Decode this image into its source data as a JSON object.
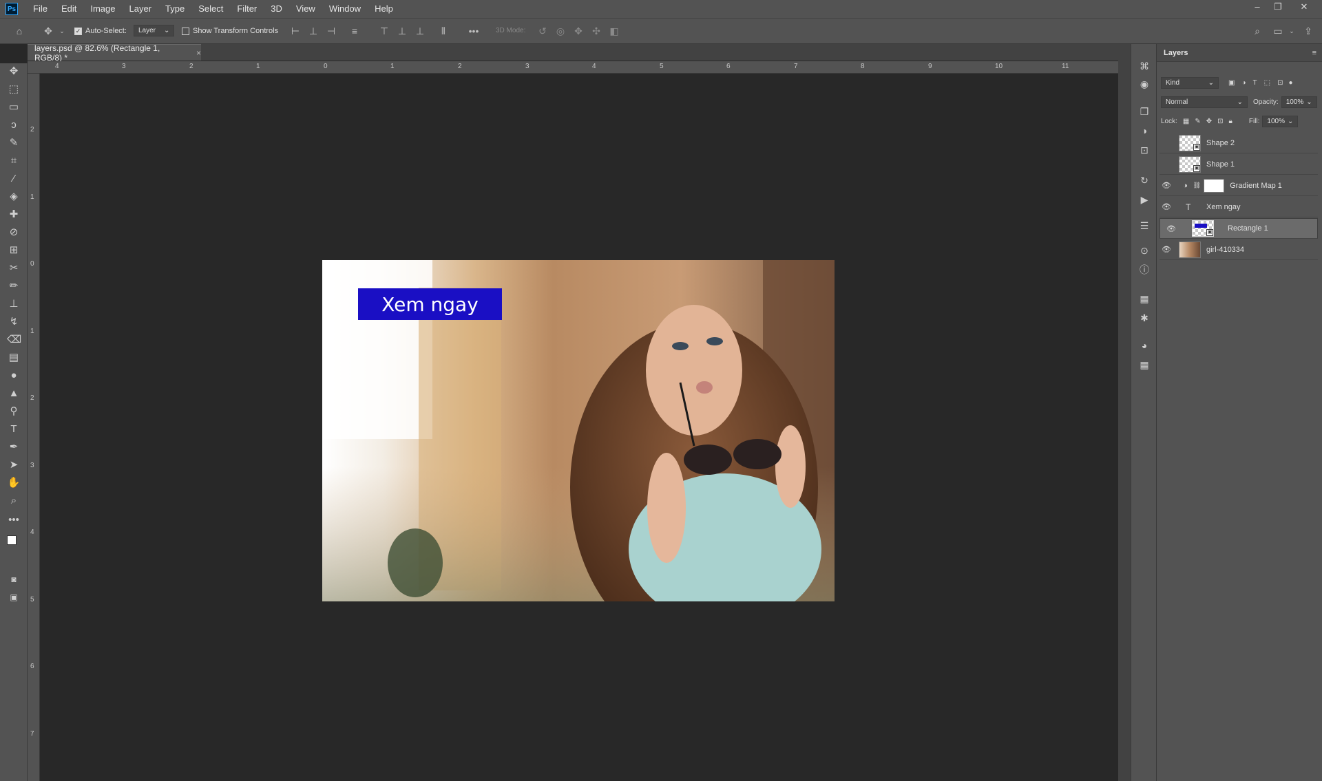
{
  "app": {
    "logo": "Ps"
  },
  "menu": [
    "File",
    "Edit",
    "Image",
    "Layer",
    "Type",
    "Select",
    "Filter",
    "3D",
    "View",
    "Window",
    "Help"
  ],
  "window_controls": {
    "minimize": "–",
    "restore": "❐",
    "close": "✕"
  },
  "options": {
    "auto_select_label": "Auto-Select:",
    "auto_select_value": "Layer",
    "show_transform_label": "Show Transform Controls",
    "mode_3d_label": "3D Mode:"
  },
  "document": {
    "tab_title": "layers.psd @ 82.6% (Rectangle 1, RGB/8) *",
    "close": "×"
  },
  "rulers": {
    "horizontal": [
      "4",
      "3",
      "2",
      "1",
      "0",
      "1",
      "2",
      "3",
      "4",
      "5",
      "6",
      "7",
      "8",
      "9",
      "10",
      "11"
    ],
    "vertical": [
      "2",
      "1",
      "0",
      "1",
      "2",
      "3",
      "4",
      "5",
      "6",
      "7"
    ]
  },
  "artwork": {
    "button_text": "Xem ngay",
    "button_color": "#1a0fc4"
  },
  "layers_panel": {
    "title": "Layers",
    "filter_kind": "Kind",
    "blend_mode": "Normal",
    "opacity_label": "Opacity:",
    "opacity_value": "100%",
    "lock_label": "Lock:",
    "fill_label": "Fill:",
    "fill_value": "100%",
    "layers": [
      {
        "name": "Shape 2",
        "visible": false
      },
      {
        "name": "Shape 1",
        "visible": false
      },
      {
        "name": "Gradient Map 1",
        "visible": true
      },
      {
        "name": "Xem ngay",
        "visible": true
      },
      {
        "name": "Rectangle 1",
        "visible": true,
        "selected": true
      },
      {
        "name": "girl-410334",
        "visible": true
      }
    ]
  }
}
